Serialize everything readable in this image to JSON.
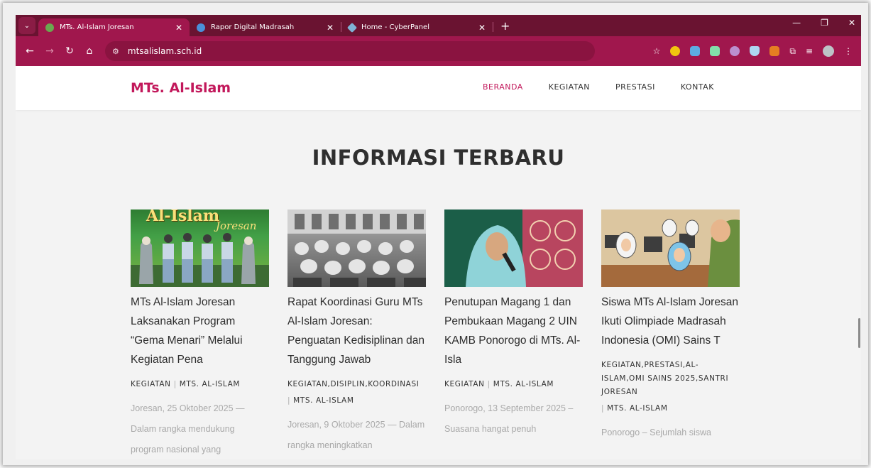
{
  "browser": {
    "tabs": [
      {
        "title": "MTs. Al-Islam Joresan",
        "active": true,
        "fav_color": "#6aa84f"
      },
      {
        "title": "Rapor Digital Madrasah",
        "active": false,
        "fav_color": "#4a90d9"
      },
      {
        "title": "Home - CyberPanel",
        "active": false,
        "fav_color": "#7fb3d5"
      }
    ],
    "tab_close": "✕",
    "new_tab": "+",
    "address": "mtsalislam.sch.id",
    "controls": {
      "minimize": "—",
      "restore": "❐",
      "close": "✕"
    }
  },
  "site": {
    "logo": "MTs. Al-Islam",
    "nav": [
      {
        "label": "BERANDA",
        "active": true
      },
      {
        "label": "KEGIATAN",
        "active": false
      },
      {
        "label": "PRESTASI",
        "active": false
      },
      {
        "label": "KONTAK",
        "active": false
      }
    ]
  },
  "section": {
    "title": "INFORMASI TERBARU"
  },
  "posts": [
    {
      "title": "MTs Al-Islam Joresan Laksanakan Program “Gema Menari” Melalui Kegiatan Pena",
      "categories": "KEGIATAN",
      "author": "MTS. AL-ISLAM",
      "excerpt": "Joresan, 25 Oktober 2025 — Dalam rangka mendukung program nasional yang",
      "thumb_label": "Al-Islam",
      "thumb_sub": "Joresan"
    },
    {
      "title": "Rapat Koordinasi Guru MTs Al-Islam Joresan: Penguatan Kedisiplinan dan Tanggung Jawab",
      "categories": "KEGIATAN,DISIPLIN,KOORDINASI",
      "author": "MTS. AL-ISLAM",
      "excerpt": "Joresan, 9 Oktober 2025 — Dalam rangka meningkatkan"
    },
    {
      "title": "Penutupan Magang 1 dan Pembukaan Magang 2 UIN KAMB Ponorogo di MTs. Al-Isla",
      "categories": "KEGIATAN",
      "author": "MTS. AL-ISLAM",
      "excerpt": "Ponorogo, 13 September 2025 – Suasana hangat penuh"
    },
    {
      "title": "Siswa MTs Al-Islam Joresan Ikuti Olimpiade Madrasah Indonesia (OMI) Sains T",
      "categories": "KEGIATAN,PRESTASI,AL-ISLAM,OMI SAINS 2025,SANTRI JORESAN",
      "author": "MTS. AL-ISLAM",
      "excerpt": "Ponorogo – Sejumlah siswa"
    }
  ]
}
